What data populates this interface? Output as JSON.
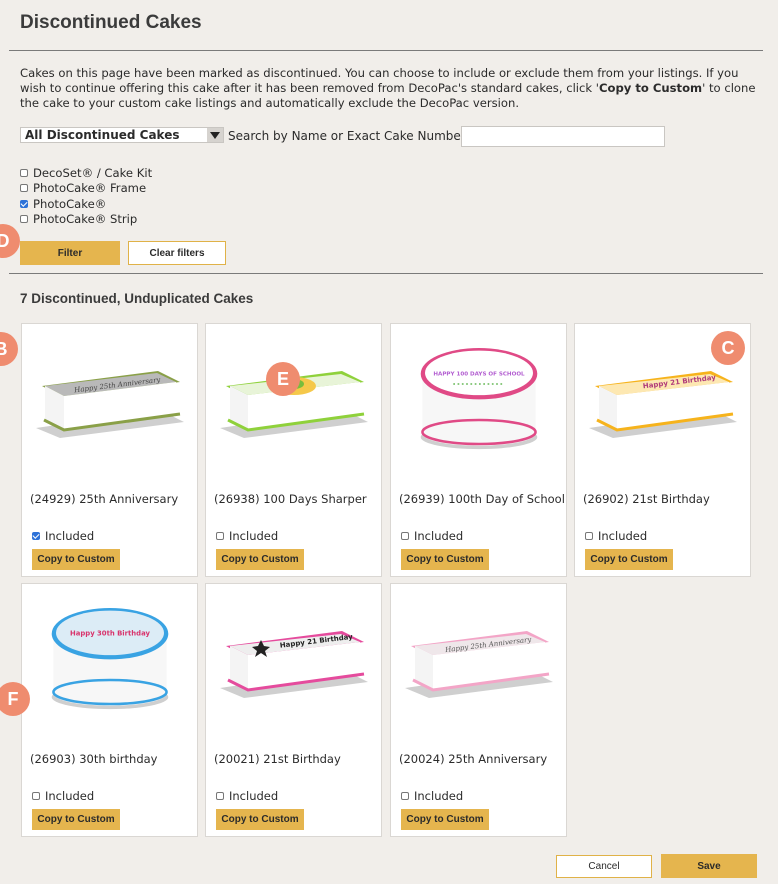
{
  "page": {
    "title": "Discontinued Cakes",
    "intro_1": "Cakes on this page have been marked as discontinued. You can choose to include or exclude them from your listings. If you wish to continue offering this cake after it has been removed from DecoPac's standard cakes, click '",
    "intro_bold": "Copy to Custom",
    "intro_2": "' to clone the cake to your custom cake listings and automatically exclude the DecoPac version."
  },
  "filter_bar": {
    "select_value": "All Discontinued Cakes",
    "search_label": "Search by Name or Exact Cake Number:",
    "search_value": ""
  },
  "filters": [
    {
      "label": "DecoSet® / Cake Kit",
      "checked": false
    },
    {
      "label": "PhotoCake® Frame",
      "checked": false
    },
    {
      "label": "PhotoCake®",
      "checked": true
    },
    {
      "label": "PhotoCake® Strip",
      "checked": false
    }
  ],
  "buttons": {
    "filter": "Filter",
    "clear": "Clear filters",
    "cancel": "Cancel",
    "save": "Save",
    "copy": "Copy to Custom"
  },
  "results_title": "7 Discontinued, Unduplicated Cakes",
  "included_label": "Included",
  "cakes": [
    {
      "name": "(24929) 25th Anniversary",
      "included": true
    },
    {
      "name": "(26938) 100 Days Sharper",
      "included": false
    },
    {
      "name": "(26939) 100th Day of School",
      "included": false
    },
    {
      "name": "(26902) 21st Birthday",
      "included": false
    },
    {
      "name": "(26903) 30th birthday",
      "included": false
    },
    {
      "name": "(20021) 21st Birthday",
      "included": false
    },
    {
      "name": "(20024) 25th Anniversary",
      "included": false
    }
  ],
  "cake_art": {
    "c1": "Happy 25th Anniversary",
    "c3": "HAPPY 100 DAYS OF SCHOOL",
    "c4": "Happy 21 Birthday",
    "c5": "Happy 30th Birthday",
    "c6": "Happy 21 Birthday",
    "c7": "Happy 25th Anniversary"
  },
  "markers": [
    "D",
    "B",
    "E",
    "C",
    "F"
  ],
  "colors": {
    "background": "#f1eeea",
    "gold": "#e5b54e",
    "marker": "#ef8c6f",
    "checkbox": "#2e72d8"
  }
}
